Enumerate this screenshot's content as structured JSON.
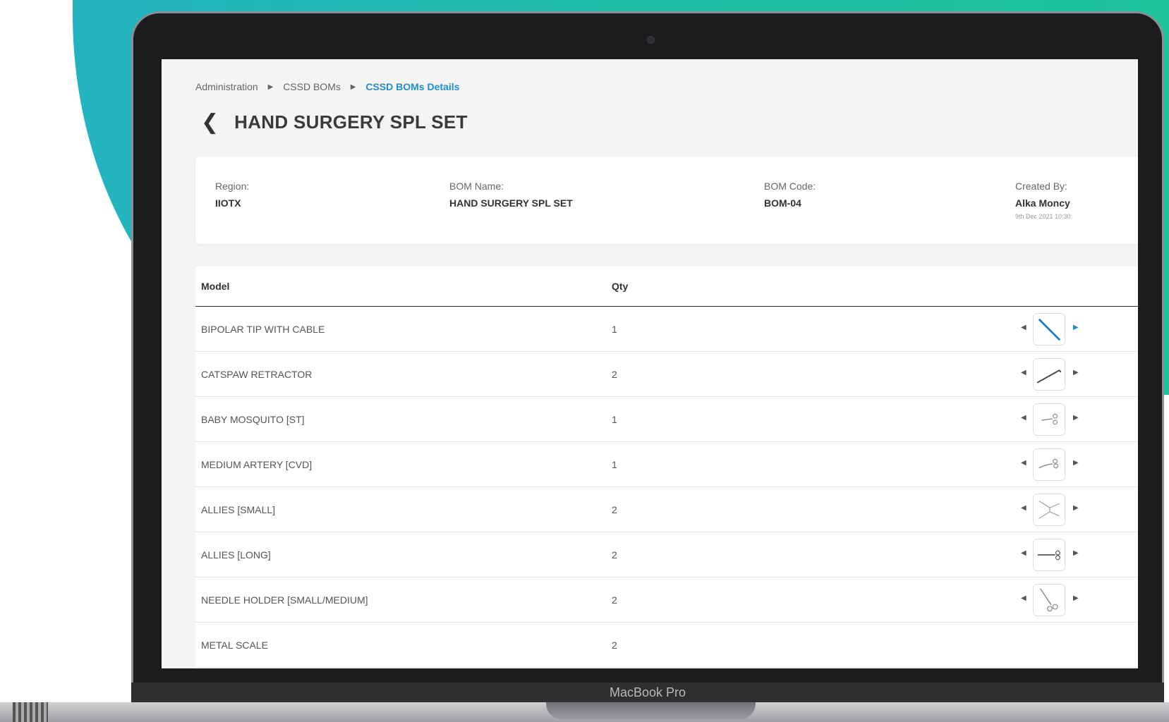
{
  "device": {
    "label": "MacBook Pro"
  },
  "breadcrumb": {
    "items": [
      "Administration",
      "CSSD BOMs",
      "CSSD BOMs Details"
    ]
  },
  "header": {
    "title": "HAND SURGERY SPL SET"
  },
  "info": {
    "region_label": "Region:",
    "region_value": "IIOTX",
    "bom_name_label": "BOM Name:",
    "bom_name_value": "HAND SURGERY SPL SET",
    "bom_code_label": "BOM Code:",
    "bom_code_value": "BOM-04",
    "created_by_label": "Created By:",
    "created_by_value": "Alka Moncy",
    "created_date": "9th Dec 2021 10:30:"
  },
  "table": {
    "columns": [
      "Model",
      "Qty"
    ],
    "rows": [
      {
        "model": "BIPOLAR TIP WITH CABLE",
        "qty": "1",
        "icon": "bipolar-tip-icon"
      },
      {
        "model": "CATSPAW RETRACTOR",
        "qty": "2",
        "icon": "retractor-icon"
      },
      {
        "model": "BABY MOSQUITO [ST]",
        "qty": "1",
        "icon": "mosquito-forceps-icon"
      },
      {
        "model": "MEDIUM ARTERY [CVD]",
        "qty": "1",
        "icon": "artery-forceps-icon"
      },
      {
        "model": "ALLIES [SMALL]",
        "qty": "2",
        "icon": "allis-forceps-icon"
      },
      {
        "model": "ALLIES [LONG]",
        "qty": "2",
        "icon": "allis-long-icon"
      },
      {
        "model": "NEEDLE HOLDER [SMALL/MEDIUM]",
        "qty": "2",
        "icon": "needle-holder-icon"
      },
      {
        "model": "METAL SCALE",
        "qty": "2",
        "icon": ""
      }
    ]
  },
  "colors": {
    "accent": "#1e8ed6",
    "teal_start": "#24b3c0",
    "teal_end": "#1fc39c"
  }
}
